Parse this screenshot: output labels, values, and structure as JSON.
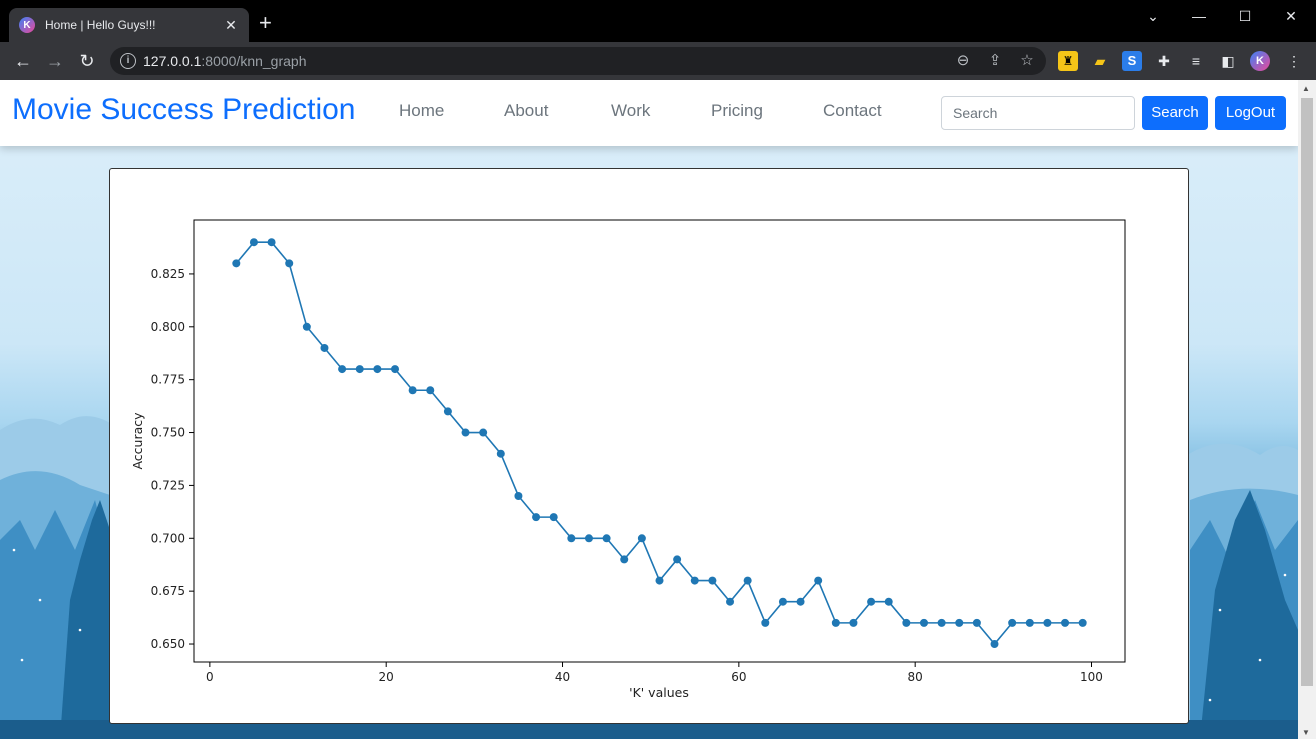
{
  "browser": {
    "tab_title": "Home | Hello Guys!!!",
    "favicon_letter": "K",
    "url_host": "127.0.0.1",
    "url_path": ":8000/knn_graph",
    "profile_letter": "K"
  },
  "navbar": {
    "brand": "Movie Success Prediction",
    "links": [
      "Home",
      "About",
      "Work",
      "Pricing",
      "Contact"
    ],
    "search_placeholder": "Search",
    "search_button": "Search",
    "logout_button": "LogOut"
  },
  "colors": {
    "primary": "#0d6efd",
    "series": "#1f77b4",
    "nav_link": "#6c757d"
  },
  "chart_data": {
    "type": "line",
    "xlabel": "'K' values",
    "ylabel": "Accuracy",
    "xlim": [
      -1.8,
      103.8
    ],
    "ylim": [
      0.6415,
      0.8505
    ],
    "xticks": [
      0,
      20,
      40,
      60,
      80,
      100
    ],
    "yticks": [
      0.65,
      0.675,
      0.7,
      0.725,
      0.75,
      0.775,
      0.8,
      0.825
    ],
    "ytick_labels": [
      "0.650",
      "0.675",
      "0.700",
      "0.725",
      "0.750",
      "0.775",
      "0.800",
      "0.825"
    ],
    "marker": "circle",
    "grid": false,
    "series": [
      {
        "x": [
          3,
          5,
          7,
          9,
          11,
          13,
          15,
          17,
          19,
          21,
          23,
          25,
          27,
          29,
          31,
          33,
          35,
          37,
          39,
          41,
          43,
          45,
          47,
          49,
          51,
          53,
          55,
          57,
          59,
          61,
          63,
          65,
          67,
          69,
          71,
          73,
          75,
          77,
          79,
          81,
          83,
          85,
          87,
          89,
          91,
          93,
          95,
          97,
          99
        ],
        "values": [
          0.83,
          0.84,
          0.84,
          0.83,
          0.8,
          0.79,
          0.78,
          0.78,
          0.78,
          0.78,
          0.77,
          0.77,
          0.76,
          0.75,
          0.75,
          0.74,
          0.72,
          0.71,
          0.71,
          0.7,
          0.7,
          0.7,
          0.69,
          0.7,
          0.68,
          0.69,
          0.68,
          0.68,
          0.67,
          0.68,
          0.66,
          0.67,
          0.67,
          0.68,
          0.66,
          0.66,
          0.67,
          0.67,
          0.66,
          0.66,
          0.66,
          0.66,
          0.66,
          0.65,
          0.66,
          0.66,
          0.66,
          0.66,
          0.66
        ]
      }
    ]
  }
}
